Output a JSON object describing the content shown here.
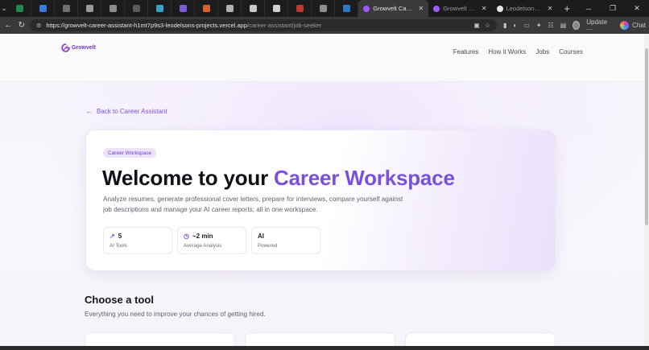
{
  "browser": {
    "tabs": [
      {
        "title": "Growvelt Career A",
        "active": true,
        "favicon_color": "#a259ff"
      },
      {
        "title": "Growvelt - Find J",
        "active": false,
        "favicon_color": "#a259ff"
      },
      {
        "title": "Leodelson/growv",
        "active": false,
        "favicon_color": "#e6e6e6"
      }
    ],
    "url_host": "https://growvelt-career-assistant-h1mt7p9s3-leodelsons-projects.vercel.app",
    "url_path": "/career-assistant/job-seeker",
    "update_label": "Update",
    "chat_label": "Chat"
  },
  "site": {
    "brand": "Growvelt",
    "nav": [
      "Features",
      "How it Works",
      "Jobs",
      "Courses"
    ],
    "accent": "#7a4fe0"
  },
  "hero": {
    "back_label": "Back to Career Assistant",
    "pill": "Career Workspace",
    "title_main": "Welcome to your ",
    "title_accent": "Career Workspace",
    "description": "Analyze resumes, generate professional cover letters, prepare for interviews, compare yourself against job descriptions and manage your AI career reports; all in one workspace.",
    "stats": [
      {
        "value": "5",
        "label": "AI Tools",
        "icon": "trend-up-icon"
      },
      {
        "value": "~2 min",
        "label": "Average Analysis",
        "icon": "clock-icon"
      },
      {
        "value": "AI",
        "label": "Powered",
        "icon": ""
      }
    ]
  },
  "tools": {
    "title": "Choose a tool",
    "subtitle": "Everything you need to improve your chances of getting hired."
  }
}
